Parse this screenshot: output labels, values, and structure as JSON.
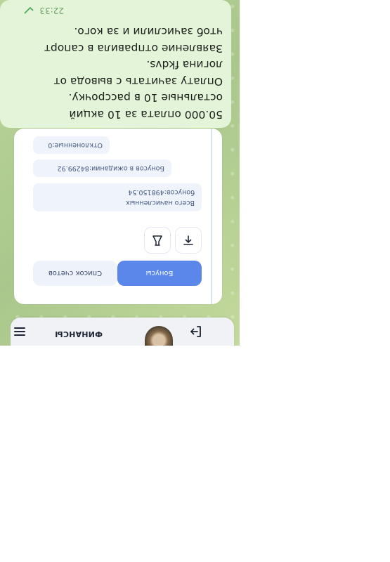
{
  "header": {
    "title": "ФИНАНСЫ"
  },
  "tabs": {
    "bonuses_label": "Бонусы",
    "accounts_label": "Список счетов"
  },
  "stats": {
    "total_line1": "Всего начисленных",
    "total_line2": "бонусов:498150.54",
    "pending": "Бонусов в ожидании:84299.92",
    "rejected": "Отклоненные:0"
  },
  "message": {
    "lines": [
      "50.000 оплата за 10 акций",
      "остальные 10 в рассрочку.",
      "Оплату зачитать с вывода от",
      "логина  fkdvs.",
      "Заявление отправила в сапорт",
      "чтоб зачислили и за кого."
    ],
    "time": "22:33"
  },
  "icons": {
    "menu": "menu-icon",
    "logout": "logout-icon",
    "upload": "upload-icon",
    "filter": "flask-icon",
    "read_receipt": "check-icon"
  },
  "colors": {
    "accent": "#5b87ea",
    "bubble": "#e4f4d8",
    "time": "#6fa06a"
  }
}
